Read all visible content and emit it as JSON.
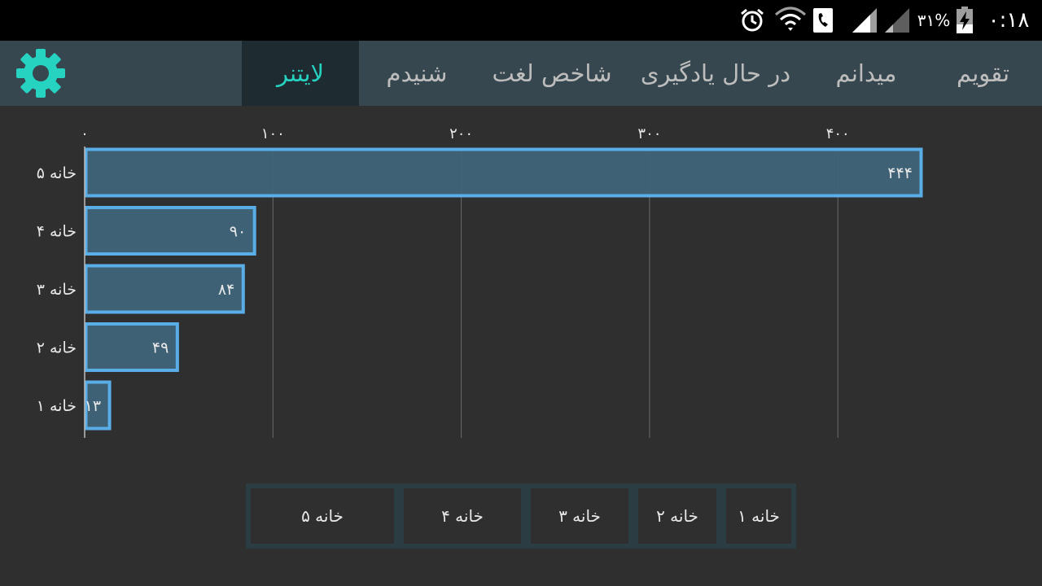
{
  "status_bar": {
    "battery_percent": "٣١%",
    "time": "٠:١٨",
    "icons": [
      "alarm-icon",
      "wifi-icon",
      "phone-icon",
      "signal-icon",
      "signal-icon",
      "battery-charging-icon"
    ]
  },
  "tabs": [
    {
      "label": "تقویم",
      "active": false
    },
    {
      "label": "میدانم",
      "active": false
    },
    {
      "label": "در حال یادگیری",
      "active": false
    },
    {
      "label": "شاخص لغت",
      "active": false
    },
    {
      "label": "شنیدم",
      "active": false
    },
    {
      "label": "لایتنر",
      "active": true
    }
  ],
  "settings_icon": "gear-icon",
  "colors": {
    "accent": "#26d2c0",
    "bar_fill": "#3f6479",
    "bar_border": "#5aaee8",
    "tabbar_bg": "#37474f",
    "active_tab_bg": "#1e2b31",
    "background": "#2f2f2f",
    "grid": "#6a6a6a"
  },
  "chart_data": {
    "type": "bar",
    "orientation": "horizontal",
    "categories": [
      "خانه ۵",
      "خانه ۴",
      "خانه ۳",
      "خانه ۲",
      "خانه ۱"
    ],
    "values": [
      444,
      90,
      84,
      49,
      13
    ],
    "value_labels": [
      "۴۴۴",
      "۹۰",
      "۸۴",
      "۴۹",
      "۱۳"
    ],
    "x_ticks": [
      0,
      100,
      200,
      300,
      400
    ],
    "x_tick_labels": [
      "٠",
      "١٠٠",
      "٢٠٠",
      "٣٠٠",
      "۴٠٠"
    ],
    "xlim": [
      0,
      444
    ],
    "grid": true,
    "legend_position": "bottom"
  },
  "legend": {
    "items": [
      "خانه ۵",
      "خانه ۴",
      "خانه ۳",
      "خانه ۲",
      "خانه ۱"
    ]
  }
}
